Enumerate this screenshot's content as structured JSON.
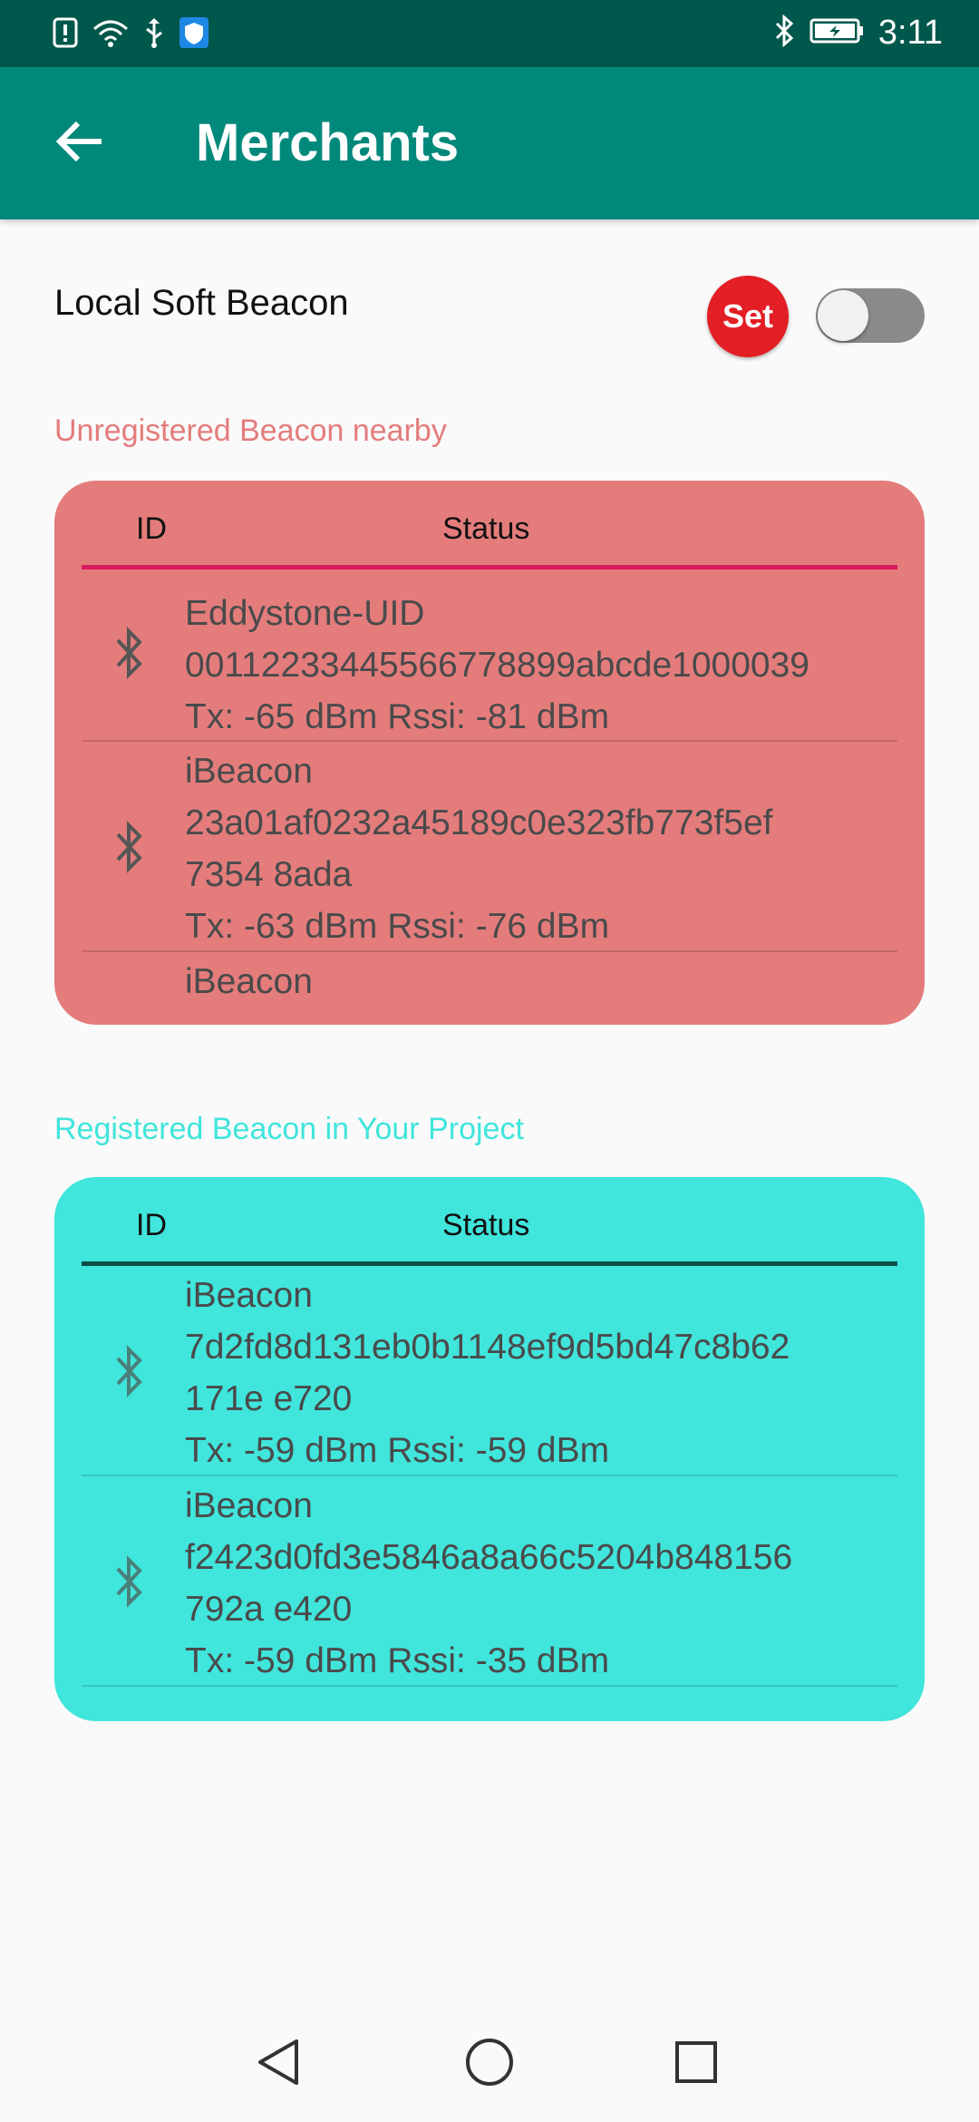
{
  "status_bar": {
    "time": "3:11"
  },
  "app_bar": {
    "title": "Merchants"
  },
  "local_beacon": {
    "label": "Local Soft Beacon",
    "set_label": "Set",
    "toggle_on": false
  },
  "unregistered": {
    "section_label": "Unregistered Beacon nearby",
    "col_id": "ID",
    "col_status": "Status",
    "rows": [
      {
        "lines": [
          "Eddystone-UID",
          "00112233445566778899abcde1000039",
          "Tx: -65 dBm  Rssi: -81 dBm"
        ]
      },
      {
        "lines": [
          "iBeacon",
          "23a01af0232a45189c0e323fb773f5ef",
          "7354  8ada",
          "Tx: -63 dBm  Rssi: -76 dBm"
        ]
      },
      {
        "lines": [
          "iBeacon"
        ]
      }
    ]
  },
  "registered": {
    "section_label": "Registered Beacon in Your Project",
    "col_id": "ID",
    "col_status": "Status",
    "rows": [
      {
        "lines": [
          "iBeacon",
          "7d2fd8d131eb0b1148ef9d5bd47c8b62",
          "171e  e720",
          "Tx: -59 dBm  Rssi: -59 dBm"
        ]
      },
      {
        "lines": [
          "iBeacon",
          "f2423d0fd3e5846a8a66c5204b848156",
          "792a  e420",
          "Tx: -59 dBm  Rssi: -35 dBm"
        ]
      }
    ]
  },
  "colors": {
    "status_bar": "#00574b",
    "app_bar": "#00897b",
    "set_button": "#e31e24",
    "unregistered_card": "#e47c7c",
    "unregistered_label": "#e47c7c",
    "unregistered_divider": "#d81b60",
    "registered_card": "#40e5dc",
    "registered_label": "#40e5dc",
    "registered_divider": "#0a4f48"
  },
  "icons": {
    "status_left": [
      "alert-icon",
      "wifi-icon",
      "usb-icon",
      "shield-icon"
    ],
    "status_right": [
      "bluetooth-icon",
      "battery-icon"
    ],
    "back": "arrow-back-icon",
    "row": "bluetooth-icon",
    "nav": [
      "nav-back-icon",
      "nav-home-icon",
      "nav-recents-icon"
    ]
  }
}
